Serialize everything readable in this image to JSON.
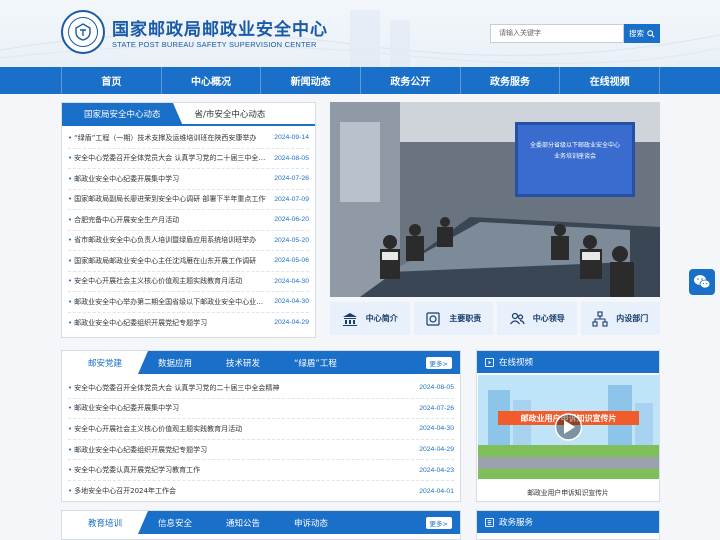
{
  "header": {
    "title": "国家邮政局邮政业安全中心",
    "subtitle": "STATE POST BUREAU SAFETY SUPERVISION CENTER",
    "emblem_text": "邮政业安全中心",
    "search": {
      "placeholder": "请输入关键字",
      "button_label": "搜索"
    }
  },
  "nav": [
    "首页",
    "中心概况",
    "新闻动态",
    "政务公开",
    "政务服务",
    "在线视频"
  ],
  "news_panel": {
    "tabs": [
      "国家局安全中心动态",
      "省/市安全中心动态"
    ],
    "items": [
      {
        "title": "“绿盾”工程（一期）技术支撑及运维培训班在陕西安康举办",
        "date": "2024-09-14"
      },
      {
        "title": "安全中心党委召开全体党员大会 认真学习党的二十届三中全会精神",
        "date": "2024-08-05"
      },
      {
        "title": "邮政业安全中心纪委开展集中学习",
        "date": "2024-07-26"
      },
      {
        "title": "国家邮政局副局长廖进荣到安全中心调研 部署下半年重点工作",
        "date": "2024-07-09"
      },
      {
        "title": "合肥完备中心开展安全生产月活动",
        "date": "2024-06-20"
      },
      {
        "title": "省市邮政业安全中心负责人培训暨绿盾应用系统培训班举办",
        "date": "2024-05-20"
      },
      {
        "title": "国家邮政局邮政业安全中心主任沈鸿雁在山东开展工作调研",
        "date": "2024-05-06"
      },
      {
        "title": "安全中心开展社会主义核心价值观主题实践教育月活动",
        "date": "2024-04-30"
      },
      {
        "title": "邮政业安全中心举办第二期全国省级以下邮政业安全中心业务培训",
        "date": "2024-04-30"
      },
      {
        "title": "邮政业安全中心纪委组织开展党纪专题学习",
        "date": "2024-04-29"
      }
    ]
  },
  "photo": {
    "screen_title_line1": "全委部分省级以下邮政业安全中心",
    "screen_title_line2": "业务培训座谈会"
  },
  "quick_links": [
    "中心简介",
    "主要职责",
    "中心领导",
    "内设部门"
  ],
  "party_panel": {
    "tabs": [
      "邮安党建",
      "数据应用",
      "技术研发",
      "“绿盾”工程"
    ],
    "more_label": "更多>",
    "items": [
      {
        "title": "安全中心党委召开全体党员大会 认真学习党的二十届三中全会精神",
        "date": "2024-08-05"
      },
      {
        "title": "邮政业安全中心纪委开展集中学习",
        "date": "2024-07-26"
      },
      {
        "title": "安全中心开展社会主义核心价值观主题实践教育月活动",
        "date": "2024-04-30"
      },
      {
        "title": "邮政业安全中心纪委组织开展党纪专题学习",
        "date": "2024-04-29"
      },
      {
        "title": "安全中心党委认真开展党纪学习教育工作",
        "date": "2024-04-23"
      },
      {
        "title": "多地安全中心召开2024年工作会",
        "date": "2024-04-01"
      }
    ]
  },
  "video_panel": {
    "title": "在线视频",
    "thumb_text": "邮政业用户申诉知识宣传片",
    "caption": "邮政业用户申诉知识宣传片"
  },
  "edu_panel": {
    "tabs": [
      "教育培训",
      "信息安全",
      "通知公告",
      "申诉动态"
    ],
    "more_label": "更多>"
  },
  "gov_panel": {
    "title": "政务服务"
  },
  "colors": {
    "primary": "#1a6fc8",
    "nav_divider": "#5b9be0",
    "quick_bg": "#e7f0fb"
  }
}
